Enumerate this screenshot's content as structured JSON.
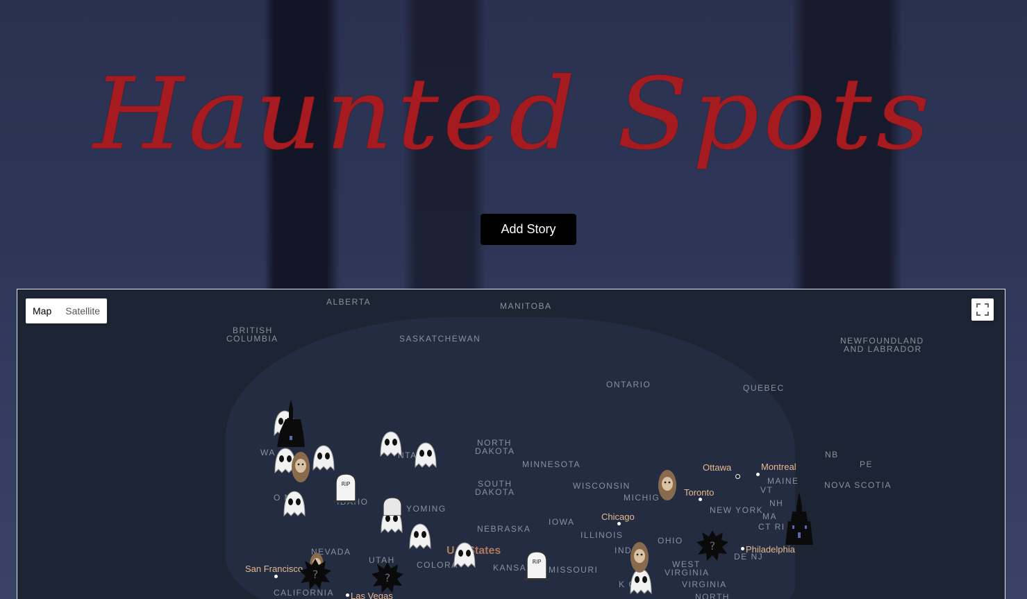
{
  "header": {
    "title": "Haunted Spots",
    "add_story_label": "Add Story"
  },
  "map": {
    "map_type": {
      "map_label": "Map",
      "satellite_label": "Satellite",
      "selected": "Map"
    },
    "fullscreen_icon": "fullscreen-icon",
    "regions": {
      "alberta": "ALBERTA",
      "manitoba": "MANITOBA",
      "british_columbia_1": "BRITISH",
      "british_columbia_2": "COLUMBIA",
      "saskatchewan": "SASKATCHEWAN",
      "newfoundland_1": "NEWFOUNDLAND",
      "newfoundland_2": "AND LABRADOR",
      "ontario": "ONTARIO",
      "quebec": "QUEBEC",
      "north_dakota_1": "NORTH",
      "north_dakota_2": "DAKOTA",
      "minnesota": "MINNESOTA",
      "south_dakota_1": "SOUTH",
      "south_dakota_2": "DAKOTA",
      "wisconsin": "WISCONSIN",
      "michigan": "MICHIG",
      "wyoming": "YOMING",
      "nebraska": "NEBRASKA",
      "iowa": "IOWA",
      "illinois": "ILLINOIS",
      "indiana": "INDI",
      "ohio": "OHIO",
      "new_york": "NEW YORK",
      "nevada": "NEVADA",
      "utah": "UTAH",
      "colorado": "COLORA",
      "kansas": "KANSA",
      "missouri": "MISSOURI",
      "california": "CALIFORNIA",
      "west_virginia_1": "WEST",
      "west_virginia_2": "VIRGINIA",
      "virginia": "VIRGINIA",
      "kentucky": "K CKY",
      "north_carolina": "NORTH",
      "nb": "NB",
      "pe": "PE",
      "maine": "MAINE",
      "nova_scotia": "NOVA SCOTIA",
      "vt": "VT",
      "nh": "NH",
      "ma": "MA",
      "ct_ri": "CT RI",
      "de_nj": "DE NJ",
      "washington": "WA",
      "oregon": "O N",
      "idaho": "IDAHO",
      "montana": "NTA"
    },
    "cities": {
      "ottawa": "Ottawa",
      "montreal": "Montreal",
      "toronto": "Toronto",
      "chicago": "Chicago",
      "philadelphia": "Philadelphia",
      "san_francisco": "San Francisco",
      "las_vegas": "Las Vegas"
    },
    "country_label": "United States",
    "country_label_visible": "U      d States",
    "marker_types": [
      "ghost-icon",
      "haunted-house-icon",
      "bigfoot-icon",
      "tombstone-icon",
      "mystery-splat-icon"
    ]
  }
}
